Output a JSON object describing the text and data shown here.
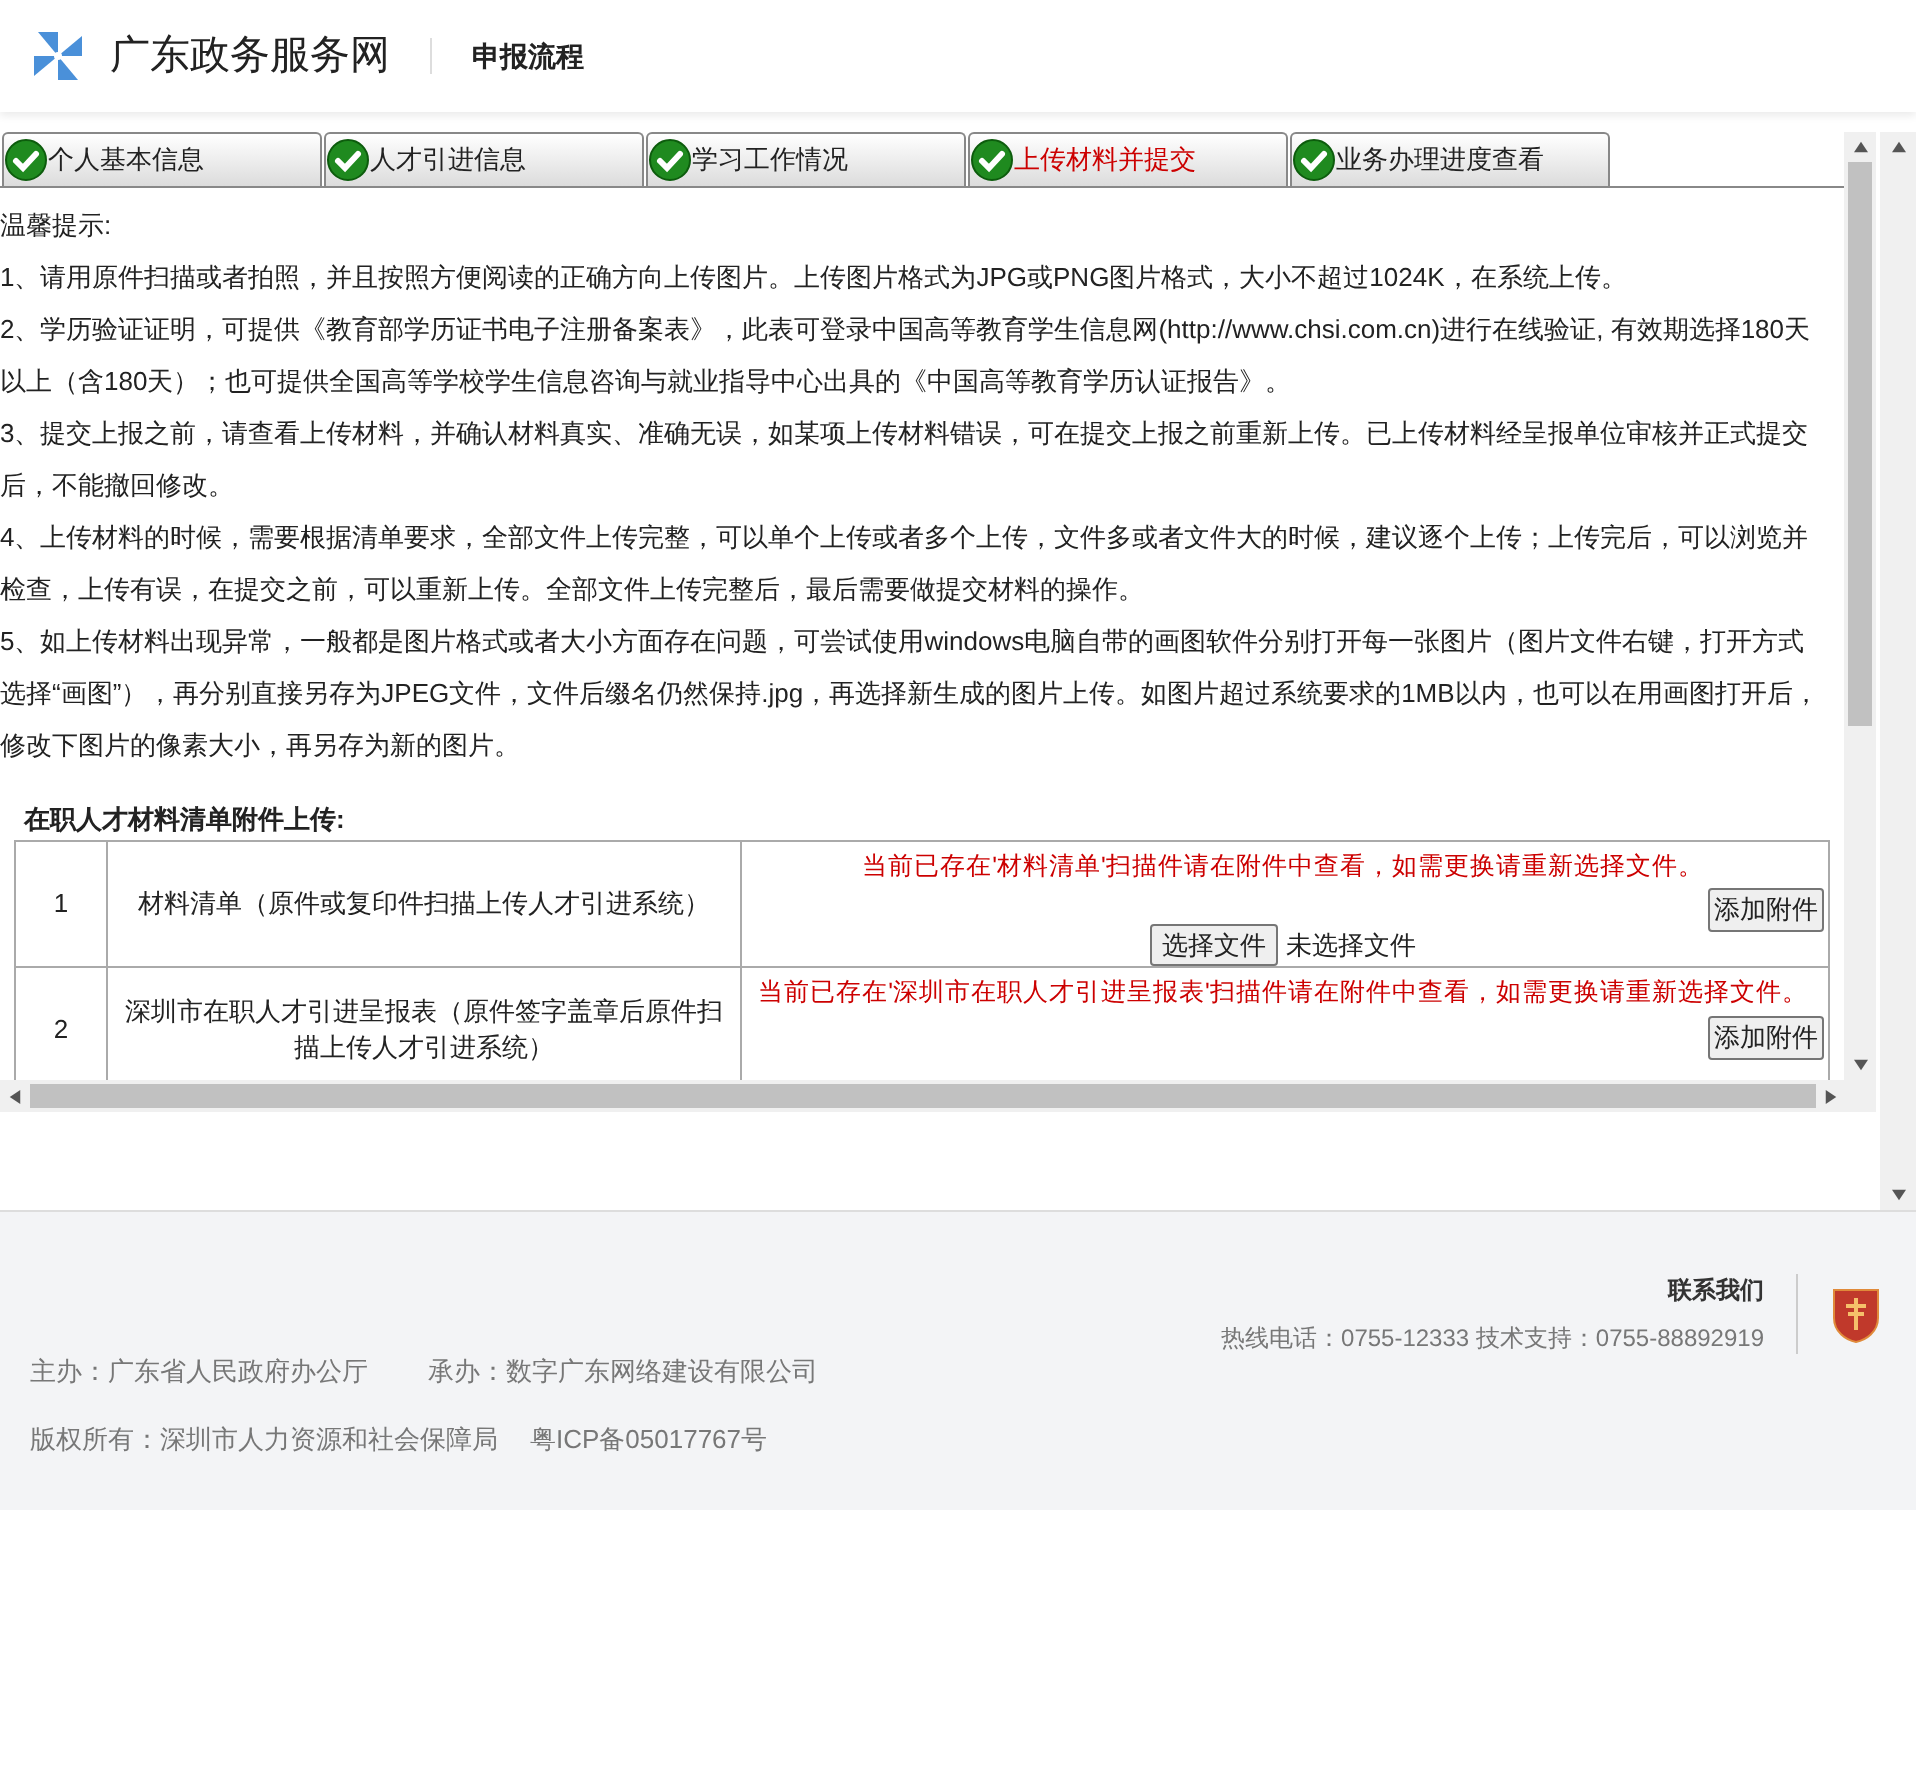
{
  "header": {
    "site_name": "广东政务服务网",
    "page_title": "申报流程"
  },
  "tabs": [
    {
      "label": "个人基本信息",
      "done": true,
      "selected": false
    },
    {
      "label": "人才引进信息",
      "done": true,
      "selected": false
    },
    {
      "label": "学习工作情况",
      "done": true,
      "selected": false
    },
    {
      "label": "上传材料并提交",
      "done": true,
      "selected": true
    },
    {
      "label": "业务办理进度查看",
      "done": true,
      "selected": false
    }
  ],
  "notice": {
    "heading": "温馨提示:",
    "items": [
      "1、请用原件扫描或者拍照，并且按照方便阅读的正确方向上传图片。上传图片格式为JPG或PNG图片格式，大小不超过1024K，在系统上传。",
      "2、学历验证证明，可提供《教育部学历证书电子注册备案表》，此表可登录中国高等教育学生信息网(http://www.chsi.com.cn)进行在线验证, 有效期选择180天以上（含180天）；也可提供全国高等学校学生信息咨询与就业指导中心出具的《中国高等教育学历认证报告》。",
      "3、提交上报之前，请查看上传材料，并确认材料真实、准确无误，如某项上传材料错误，可在提交上报之前重新上传。已上传材料经呈报单位审核并正式提交后，不能撤回修改。",
      "4、上传材料的时候，需要根据清单要求，全部文件上传完整，可以单个上传或者多个上传，文件多或者文件大的时候，建议逐个上传；上传完后，可以浏览并检查，上传有误，在提交之前，可以重新上传。全部文件上传完整后，最后需要做提交材料的操作。",
      "5、如上传材料出现异常，一般都是图片格式或者大小方面存在问题，可尝试使用windows电脑自带的画图软件分别打开每一张图片（图片文件右键，打开方式选择“画图”），再分别直接另存为JPEG文件，文件后缀名仍然保持.jpg，再选择新生成的图片上传。如图片超过系统要求的1MB以内，也可以在用画图打开后，修改下图片的像素大小，再另存为新的图片。"
    ]
  },
  "attachments": {
    "title": "在职人才材料清单附件上传:",
    "rows": [
      {
        "no": "1",
        "name": "材料清单（原件或复印件扫描上传人才引进系统）",
        "status": "当前已存在'材料清单'扫描件请在附件中查看，如需更换请重新选择文件。",
        "add_button": "添加附件",
        "choose_button": "选择文件",
        "file_status": "未选择文件"
      },
      {
        "no": "2",
        "name": "深圳市在职人才引进呈报表（原件签字盖章后原件扫描上传人才引进系统）",
        "status": "当前已存在'深圳市在职人才引进呈报表'扫描件请在附件中查看，如需更换请重新选择文件。",
        "add_button": "添加附件"
      }
    ]
  },
  "footer": {
    "contact_title": "联系我们",
    "hotline": "热线电话：0755-12333 技术支持：0755-88892919",
    "sponsor": "主办：广东省人民政府办公厅",
    "organizer": "承办：数字广东网络建设有限公司",
    "copyright": "版权所有：深圳市人力资源和社会保障局",
    "icp": "粤ICP备05017767号"
  }
}
